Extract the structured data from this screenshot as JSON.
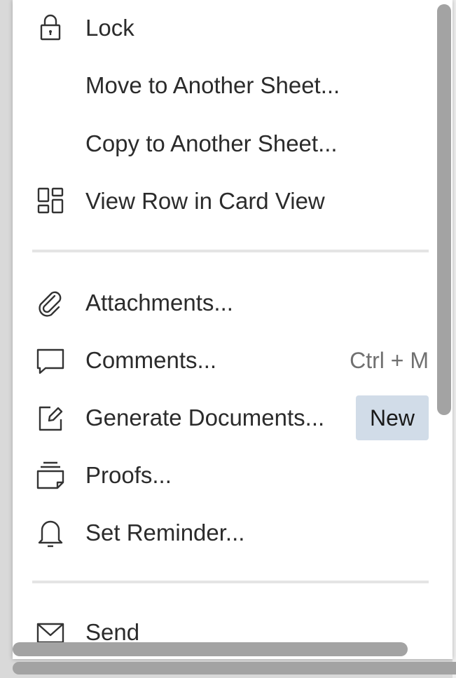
{
  "menu": {
    "items": [
      {
        "label": "Lock",
        "icon": "lock-icon"
      },
      {
        "label": "Move to Another Sheet..."
      },
      {
        "label": "Copy to Another Sheet..."
      },
      {
        "label": "View Row in Card View",
        "icon": "card-view-icon"
      },
      {
        "label": "Attachments...",
        "icon": "paperclip-icon"
      },
      {
        "label": "Comments...",
        "icon": "comment-icon",
        "shortcut": "Ctrl + M"
      },
      {
        "label": "Generate Documents...",
        "icon": "edit-document-icon",
        "badge": "New"
      },
      {
        "label": "Proofs...",
        "icon": "proofs-icon"
      },
      {
        "label": "Set Reminder...",
        "icon": "bell-icon"
      },
      {
        "label": "Send",
        "icon": "envelope-icon"
      }
    ]
  },
  "colors": {
    "badge_bg": "#d1dce8",
    "text": "#2b2b2b",
    "shortcut": "#707070",
    "divider": "#e4e4e4",
    "scrollbar": "#a3a3a3"
  }
}
